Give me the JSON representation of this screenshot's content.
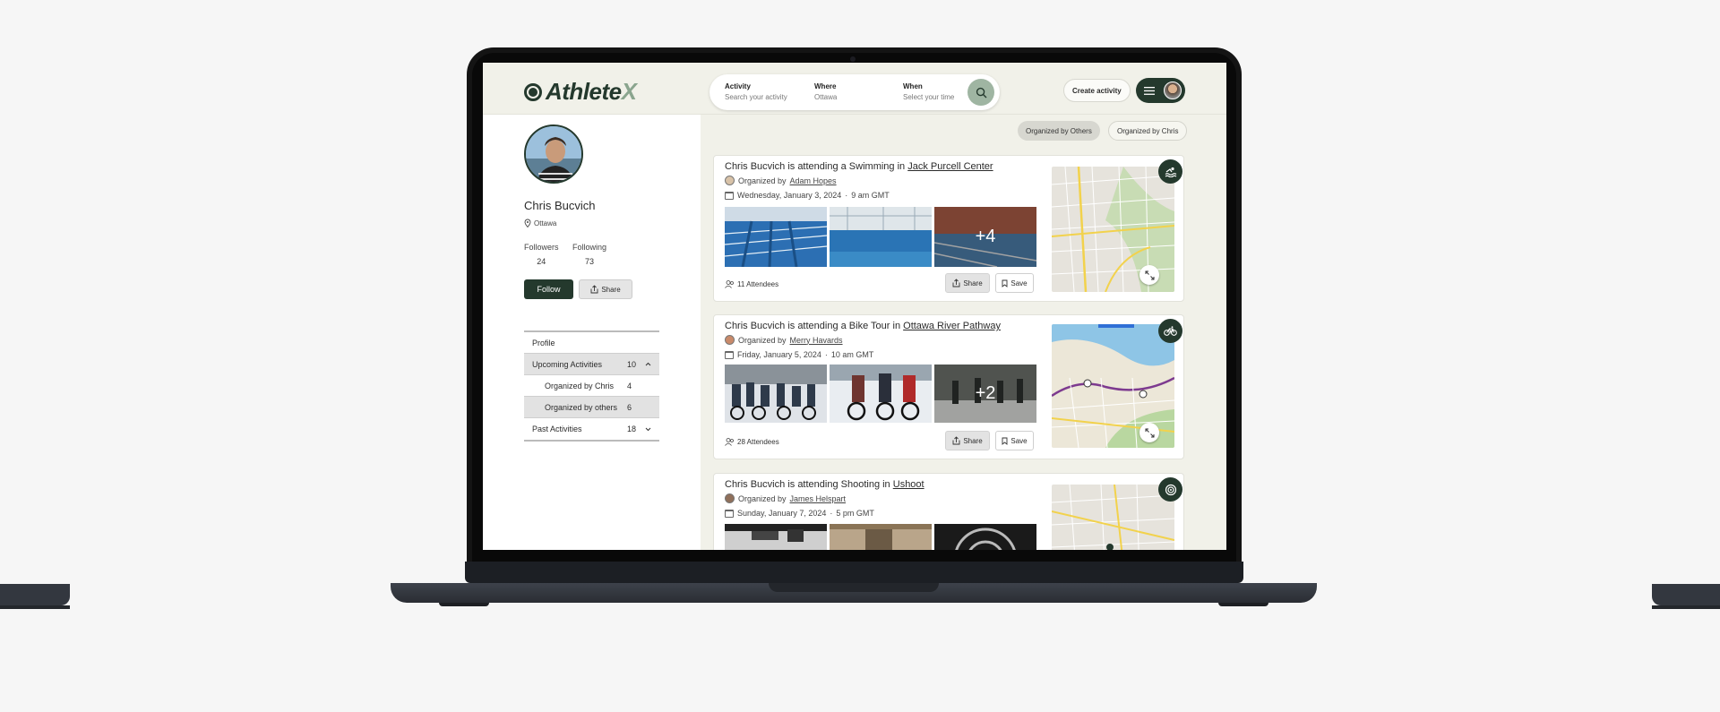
{
  "header": {
    "logo_main": "Athlete",
    "logo_accent": "X",
    "search": {
      "activity_label": "Activity",
      "activity_placeholder": "Search your activity",
      "where_label": "Where",
      "where_value": "Ottawa",
      "when_label": "When",
      "when_placeholder": "Select your time"
    },
    "create_label": "Create activity"
  },
  "profile": {
    "name": "Chris Bucvich",
    "location": "Ottawa",
    "followers_label": "Followers",
    "followers": "24",
    "following_label": "Following",
    "following": "73",
    "follow_label": "Follow",
    "share_label": "Share"
  },
  "menu": [
    {
      "label": "Profile",
      "count": ""
    },
    {
      "label": "Upcoming Activities",
      "count": "10"
    },
    {
      "label": "Organized by Chris",
      "count": "4"
    },
    {
      "label": "Organized by others",
      "count": "6"
    },
    {
      "label": "Past Activities",
      "count": "18"
    }
  ],
  "filters": {
    "others": "Organized by Others",
    "chris": "Organized by Chris"
  },
  "cards": [
    {
      "name": "Chris Bucvich",
      "verb": "is attending a Swimming in",
      "place": "Jack Purcell Center",
      "organized_by": "Organized by",
      "organizer": "Adam Hopes",
      "date": "Wednesday, January 3, 2024",
      "time": "9 am GMT",
      "more": "+4",
      "attendees": "11 Attendees",
      "share": "Share",
      "save": "Save",
      "icon": "swimming-icon"
    },
    {
      "name": "Chris Bucvich",
      "verb": "is attending a Bike Tour in",
      "place": "Ottawa River Pathway",
      "organized_by": "Organized by",
      "organizer": "Merry Havards",
      "date": "Friday, January 5, 2024",
      "time": "10 am GMT",
      "more": "+2",
      "attendees": "28 Attendees",
      "share": "Share",
      "save": "Save",
      "icon": "bicycle-icon"
    },
    {
      "name": "Chris Bucvich",
      "verb": "is attending Shooting in",
      "place": "Ushoot",
      "organized_by": "Organized by",
      "organizer": "James Helspart",
      "date": "Sunday, January 7, 2024",
      "time": "5 pm GMT",
      "icon": "target-icon"
    }
  ],
  "colors": {
    "brand_dark": "#24392d",
    "brand_light": "#8aa58e",
    "screen_bg": "#f1f1e9"
  }
}
